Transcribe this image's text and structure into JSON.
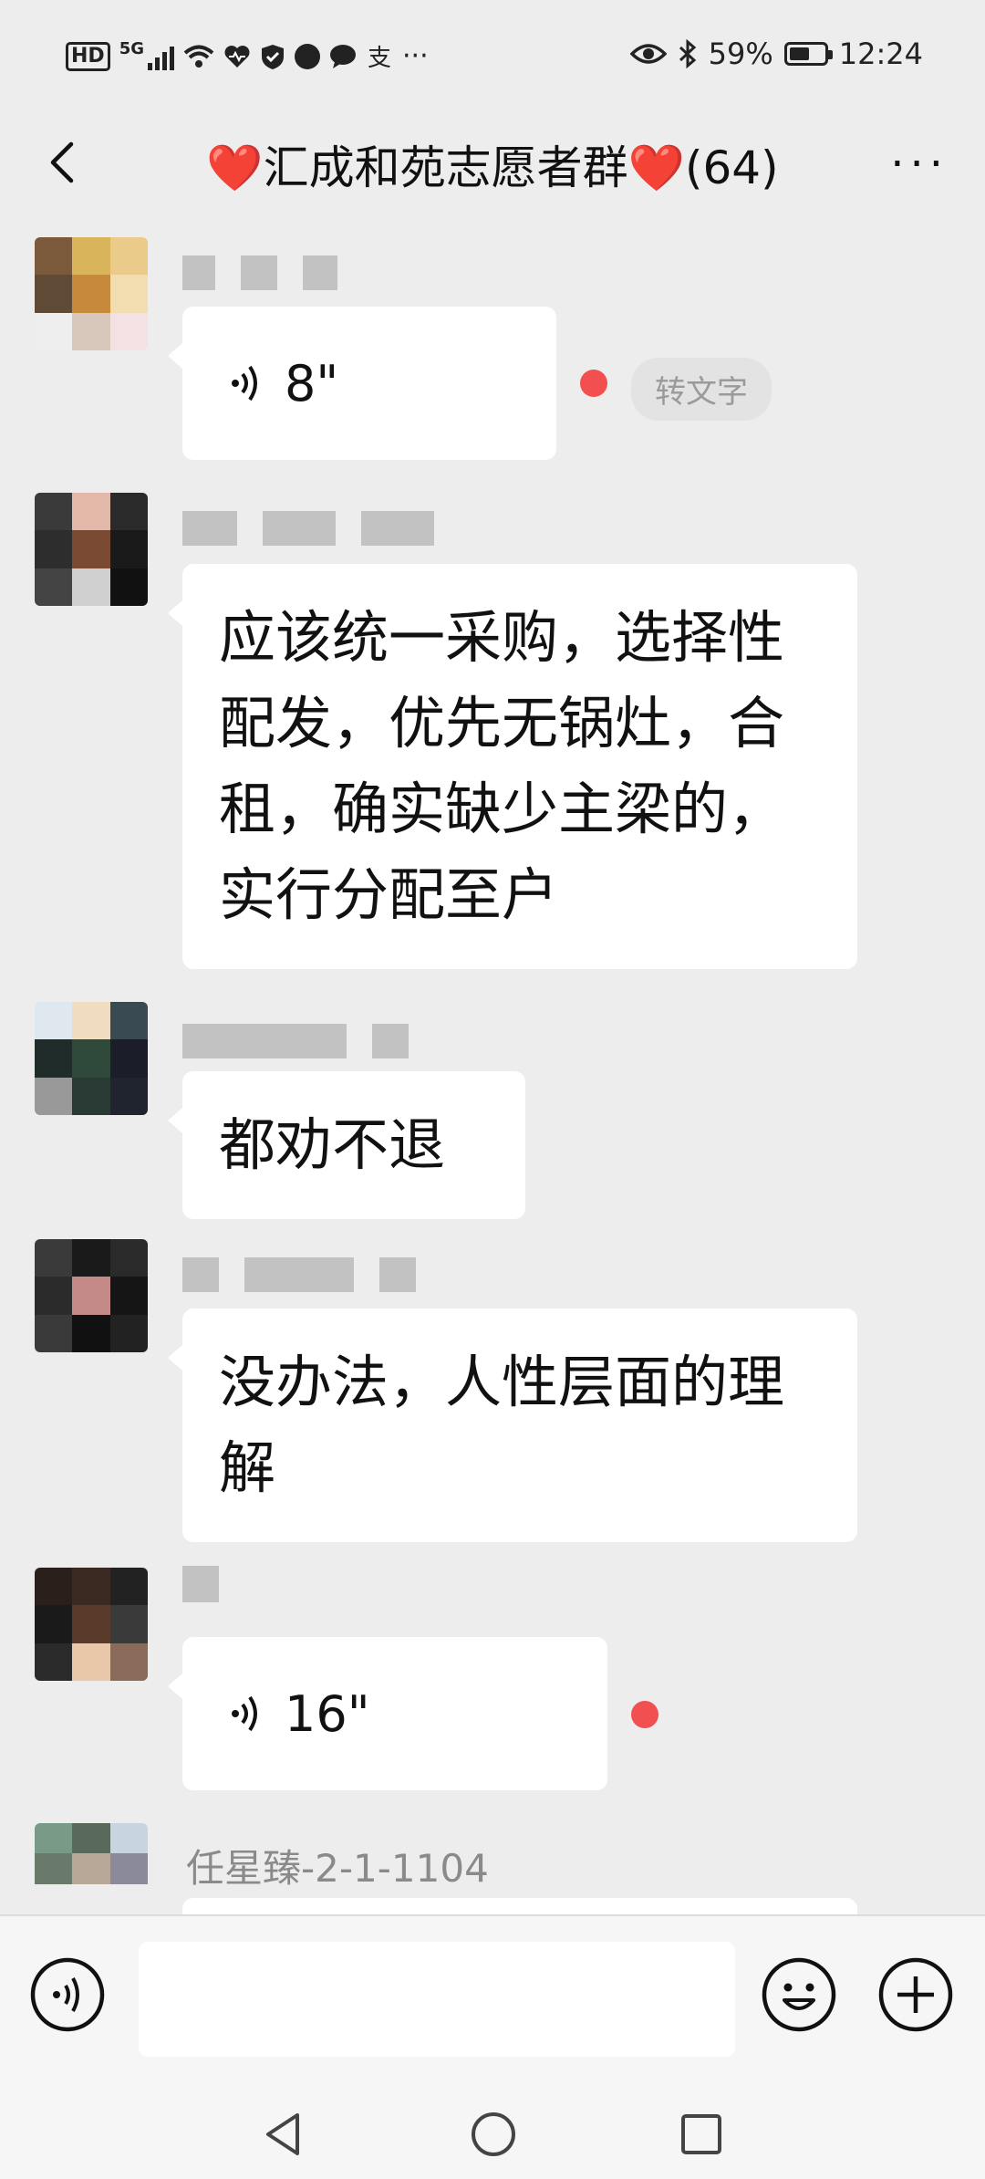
{
  "status_bar": {
    "hd": "HD",
    "net": "5G",
    "extra": "···",
    "battery_percent": "59%",
    "battery_level": 0.59,
    "time": "12:24"
  },
  "header": {
    "title": "汇成和苑志愿者群",
    "count": "(64)",
    "heart": "❤️",
    "more": "···"
  },
  "messages": [
    {
      "type": "voice",
      "duration": "8\"",
      "unread": true,
      "to_text_label": "转文字"
    },
    {
      "type": "text",
      "text": "应该统一采购，选择性配发，优先无锅灶，合租，确实缺少主梁的，实行分配至户"
    },
    {
      "type": "text",
      "text": "都劝不退"
    },
    {
      "type": "text",
      "text": "没办法，人性层面的理解"
    },
    {
      "type": "voice",
      "duration": "16\"",
      "unread": true
    },
    {
      "type": "text",
      "sender": "任星臻-2-1-1104",
      "text": ""
    }
  ],
  "colors": {
    "background": "#ededed",
    "bubble": "#ffffff",
    "heart": "#e01e2a",
    "unread_dot": "#f25050",
    "sender_name": "#8a8a8a"
  }
}
